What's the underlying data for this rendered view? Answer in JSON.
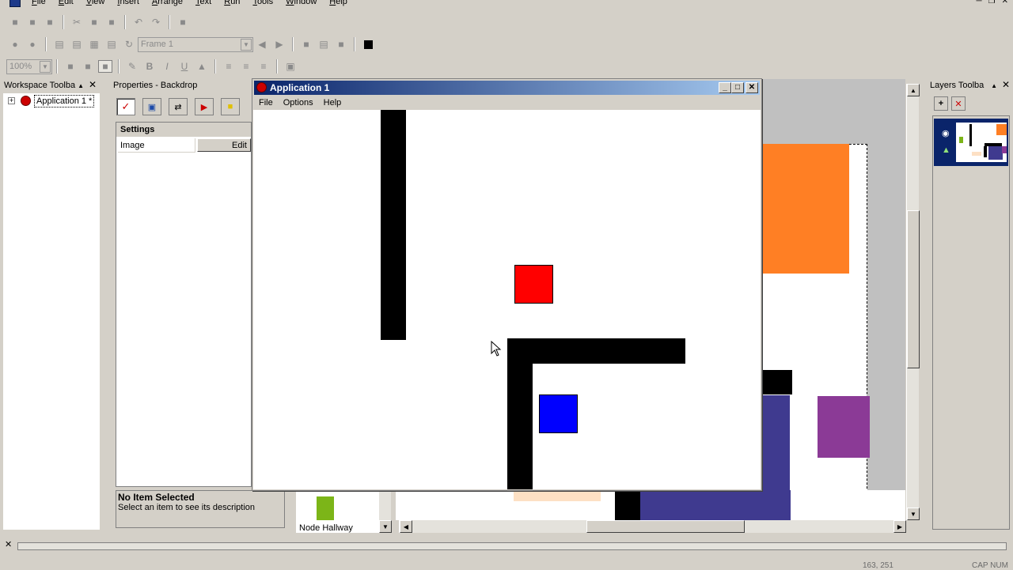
{
  "menu": {
    "items": [
      "File",
      "Edit",
      "View",
      "Insert",
      "Arrange",
      "Text",
      "Run",
      "Tools",
      "Window",
      "Help"
    ]
  },
  "toolbar": {
    "frame_combo_value": "Frame 1",
    "zoom_combo_value": "100%",
    "style_buttons": [
      "B",
      "I",
      "U"
    ]
  },
  "workspace_panel": {
    "title": "Workspace Toolba",
    "tree_item": "Application 1 *"
  },
  "properties_panel": {
    "title": "Properties - Backdrop",
    "section": "Settings",
    "row_label": "Image",
    "row_value": "Edit",
    "desc_title": "No Item Selected",
    "desc_text": "Select an item to see its description"
  },
  "app_window": {
    "title": "Application 1",
    "menu": [
      "File",
      "Options",
      "Help"
    ]
  },
  "library": {
    "item_label": "Node Hallway"
  },
  "layers_panel": {
    "title": "Layers Toolba"
  },
  "statusbar": {
    "coords": "163, 251",
    "caps": "CAP  NUM"
  },
  "colors": {
    "orange": "#ff7f24",
    "red": "#ff0000",
    "blue": "#0000ff",
    "purple": "#8b3a96",
    "navy": "#3f3a8f",
    "peach": "#fde0c4",
    "green": "#7cb518",
    "titlebar": "#0a246a"
  }
}
